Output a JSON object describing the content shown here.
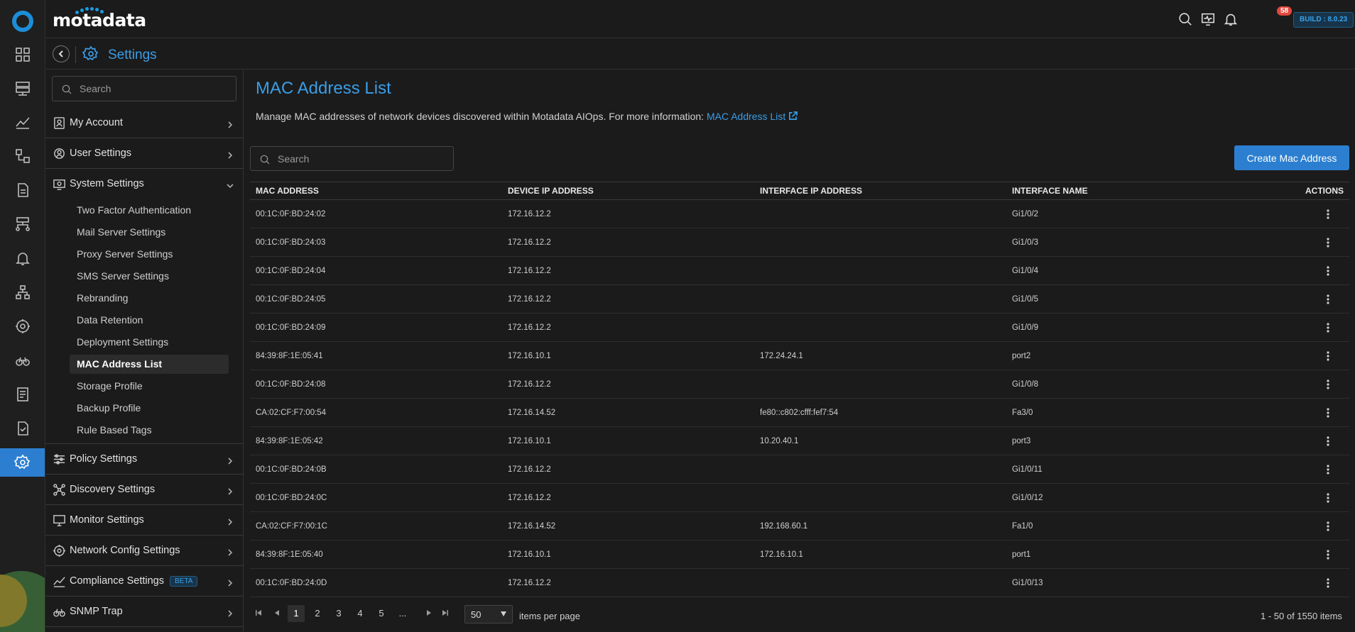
{
  "app": {
    "brand": "motadata",
    "build_label": "BUILD : 8.0.23",
    "notification_count": "58"
  },
  "rail": {
    "items": [
      "dashboard-icon",
      "server-icon",
      "metrics-icon",
      "topology-icon",
      "report-icon",
      "network-icon",
      "alert-icon",
      "hierarchy-icon",
      "ai-ops-icon",
      "explorer-icon",
      "log-icon",
      "compliance-icon",
      "settings-icon"
    ],
    "active": "settings-icon"
  },
  "breadcrumb": {
    "title": "Settings"
  },
  "sidebar": {
    "search_placeholder": "Search",
    "groups": [
      {
        "label": "My Account",
        "icon": "user-card-icon"
      },
      {
        "label": "User Settings",
        "icon": "user-gear-icon"
      },
      {
        "label": "System Settings",
        "icon": "system-gear-icon",
        "expanded": true
      },
      {
        "label": "Policy Settings",
        "icon": "sliders-icon"
      },
      {
        "label": "Discovery Settings",
        "icon": "discovery-icon"
      },
      {
        "label": "Monitor Settings",
        "icon": "monitor-icon"
      },
      {
        "label": "Network Config Settings",
        "icon": "network-config-icon"
      },
      {
        "label": "Compliance Settings",
        "icon": "compliance-chart-icon",
        "badge": "BETA"
      },
      {
        "label": "SNMP Trap",
        "icon": "binoculars-icon"
      }
    ],
    "system_items": [
      "Two Factor Authentication",
      "Mail Server Settings",
      "Proxy Server Settings",
      "SMS Server Settings",
      "Rebranding",
      "Data Retention",
      "Deployment Settings",
      "MAC Address List",
      "Storage Profile",
      "Backup Profile",
      "Rule Based Tags"
    ],
    "active_item": "MAC Address List"
  },
  "main": {
    "title": "MAC Address List",
    "description": "Manage MAC addresses of network devices discovered within Motadata AIOps. For more information: ",
    "description_link": "MAC Address List",
    "search_placeholder": "Search",
    "create_button": "Create Mac Address"
  },
  "table": {
    "columns": [
      "MAC ADDRESS",
      "DEVICE IP ADDRESS",
      "INTERFACE IP ADDRESS",
      "INTERFACE NAME",
      "ACTIONS"
    ],
    "rows": [
      [
        "00:1C:0F:BD:24:02",
        "172.16.12.2",
        "",
        "Gi1/0/2"
      ],
      [
        "00:1C:0F:BD:24:03",
        "172.16.12.2",
        "",
        "Gi1/0/3"
      ],
      [
        "00:1C:0F:BD:24:04",
        "172.16.12.2",
        "",
        "Gi1/0/4"
      ],
      [
        "00:1C:0F:BD:24:05",
        "172.16.12.2",
        "",
        "Gi1/0/5"
      ],
      [
        "00:1C:0F:BD:24:09",
        "172.16.12.2",
        "",
        "Gi1/0/9"
      ],
      [
        "84:39:8F:1E:05:41",
        "172.16.10.1",
        "172.24.24.1",
        "port2"
      ],
      [
        "00:1C:0F:BD:24:08",
        "172.16.12.2",
        "",
        "Gi1/0/8"
      ],
      [
        "CA:02:CF:F7:00:54",
        "172.16.14.52",
        "fe80::c802:cfff:fef7:54",
        "Fa3/0"
      ],
      [
        "84:39:8F:1E:05:42",
        "172.16.10.1",
        "10.20.40.1",
        "port3"
      ],
      [
        "00:1C:0F:BD:24:0B",
        "172.16.12.2",
        "",
        "Gi1/0/11"
      ],
      [
        "00:1C:0F:BD:24:0C",
        "172.16.12.2",
        "",
        "Gi1/0/12"
      ],
      [
        "CA:02:CF:F7:00:1C",
        "172.16.14.52",
        "192.168.60.1",
        "Fa1/0"
      ],
      [
        "84:39:8F:1E:05:40",
        "172.16.10.1",
        "172.16.10.1",
        "port1"
      ],
      [
        "00:1C:0F:BD:24:0D",
        "172.16.12.2",
        "",
        "Gi1/0/13"
      ]
    ]
  },
  "pagination": {
    "pages": [
      "1",
      "2",
      "3",
      "4",
      "5",
      "..."
    ],
    "current": "1",
    "per_page": "50",
    "per_page_label": "items per page",
    "range": "1 - 50 of 1550 items"
  },
  "colors": {
    "accent": "#2c7fd0",
    "link": "#3a9de6",
    "badge": "#e2483d",
    "background": "#1b1b1b"
  }
}
